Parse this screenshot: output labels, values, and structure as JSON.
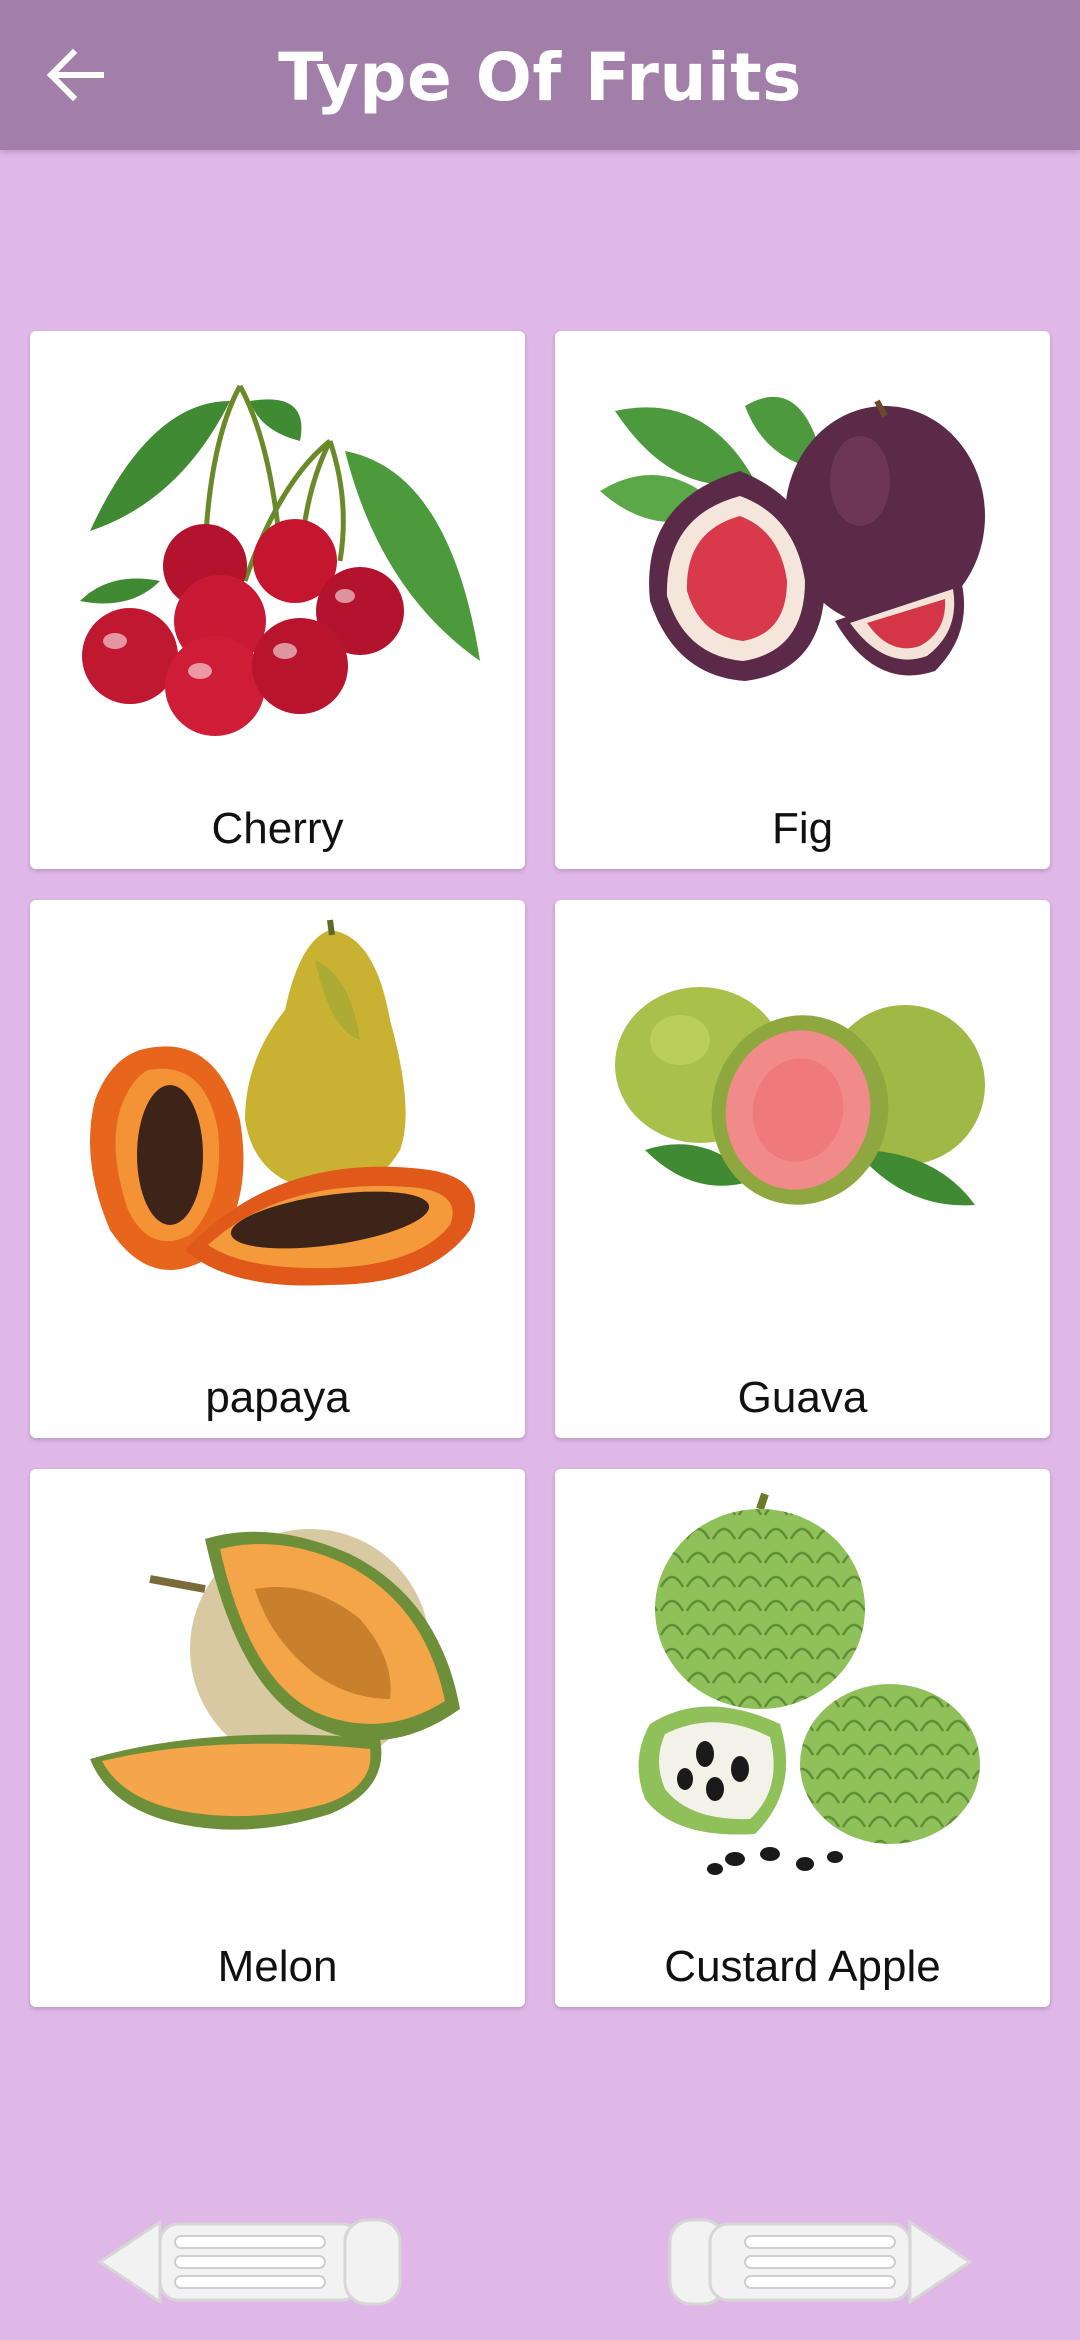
{
  "appbar": {
    "title": "Type Of Fruits",
    "back_icon": "arrow-left-icon",
    "background": "#a17fa9"
  },
  "page": {
    "background": "#e0b8e8"
  },
  "fruits": [
    {
      "label": "Cherry",
      "icon": "cherry-image"
    },
    {
      "label": "Fig",
      "icon": "fig-image"
    },
    {
      "label": "papaya",
      "icon": "papaya-image"
    },
    {
      "label": "Guava",
      "icon": "guava-image"
    },
    {
      "label": "Melon",
      "icon": "melon-image"
    },
    {
      "label": "Custard Apple",
      "icon": "custard-apple-image"
    }
  ],
  "navigation": {
    "prev_icon": "previous-arrow-icon",
    "next_icon": "next-arrow-icon"
  }
}
